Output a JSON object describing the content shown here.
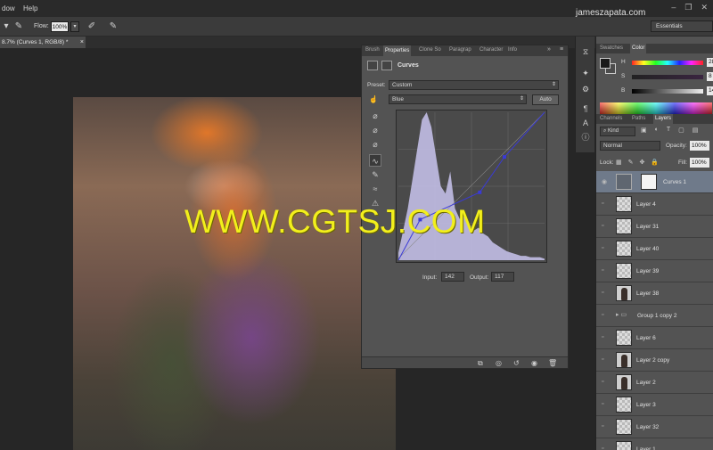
{
  "menu": {
    "items": [
      "dow",
      "Help"
    ]
  },
  "site_watermark": "jameszapata.com",
  "options_bar": {
    "flow_label": "Flow:",
    "flow_value": "100%",
    "workspace": "Essentials"
  },
  "document": {
    "tab_label": "8.7% (Curves 1, RGB/8) *",
    "close_glyph": "×"
  },
  "overlay_watermark": "WWW.CGTSJ.COM",
  "properties_panel": {
    "tabs": [
      "Brush",
      "Properties",
      "Clone So",
      "Paragrap",
      "Character",
      "Info"
    ],
    "active_tab": "Properties",
    "title": "Curves",
    "preset_label": "Preset:",
    "preset_value": "Custom",
    "channel_value": "Blue",
    "auto_label": "Auto",
    "input_label": "Input:",
    "input_value": "142",
    "output_label": "Output:",
    "output_value": "117",
    "curve_points": [
      [
        0,
        0
      ],
      [
        38,
        70
      ],
      [
        142,
        117
      ],
      [
        185,
        178
      ],
      [
        255,
        255
      ]
    ],
    "histogram_color": "#c9c4ee",
    "curve_color": "#3a3ad6"
  },
  "color_panel": {
    "tabs": [
      "Swatches",
      "Color"
    ],
    "active_tab": "Color",
    "rows": [
      {
        "label": "H",
        "value": "280",
        "unit": "°"
      },
      {
        "label": "S",
        "value": "8",
        "unit": "%"
      },
      {
        "label": "B",
        "value": "14",
        "unit": "%"
      }
    ]
  },
  "layers_panel": {
    "tabs": [
      "Channels",
      "Paths",
      "Layers"
    ],
    "active_tab": "Layers",
    "kind_label": "Kind",
    "blend_mode": "Normal",
    "opacity_label": "Opacity:",
    "opacity_value": "100%",
    "lock_label": "Lock:",
    "fill_label": "Fill:",
    "fill_value": "100%",
    "layers": [
      {
        "name": "Curves 1",
        "type": "adjustment",
        "selected": true
      },
      {
        "name": "Layer 4",
        "type": "pixel"
      },
      {
        "name": "Layer 31",
        "type": "pixel"
      },
      {
        "name": "Layer 40",
        "type": "pixel"
      },
      {
        "name": "Layer 39",
        "type": "pixel"
      },
      {
        "name": "Layer 38",
        "type": "figure"
      },
      {
        "name": "Group 1 copy 2",
        "type": "group"
      },
      {
        "name": "Layer 6",
        "type": "pixel"
      },
      {
        "name": "Layer 2 copy",
        "type": "figure"
      },
      {
        "name": "Layer 2",
        "type": "figure"
      },
      {
        "name": "Layer 3",
        "type": "pixel"
      },
      {
        "name": "Layer 32",
        "type": "pixel"
      },
      {
        "name": "Layer 1",
        "type": "pixel"
      }
    ]
  }
}
